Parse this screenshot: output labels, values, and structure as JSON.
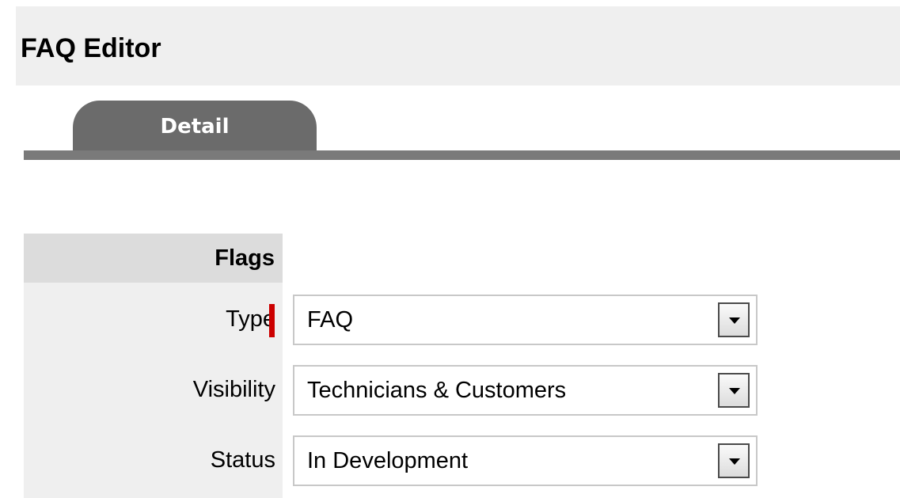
{
  "editor": {
    "title": "FAQ Editor"
  },
  "tabs": [
    {
      "label": "Detail",
      "active": true
    }
  ],
  "section": {
    "label": "Flags"
  },
  "fields": {
    "type": {
      "label": "Type",
      "value": "FAQ",
      "required": true
    },
    "visibility": {
      "label": "Visibility",
      "value": "Technicians & Customers"
    },
    "status": {
      "label": "Status",
      "value": "In Development"
    }
  },
  "colors": {
    "header_bg": "#efefef",
    "tab_bg": "#6b6b6b",
    "tab_line": "#7a7a7a",
    "section_bg": "#dcdcdc",
    "label_column_bg": "#efefef",
    "required_marker": "#cc0000"
  },
  "icons": {
    "select_arrow": "chevron-down-icon"
  }
}
